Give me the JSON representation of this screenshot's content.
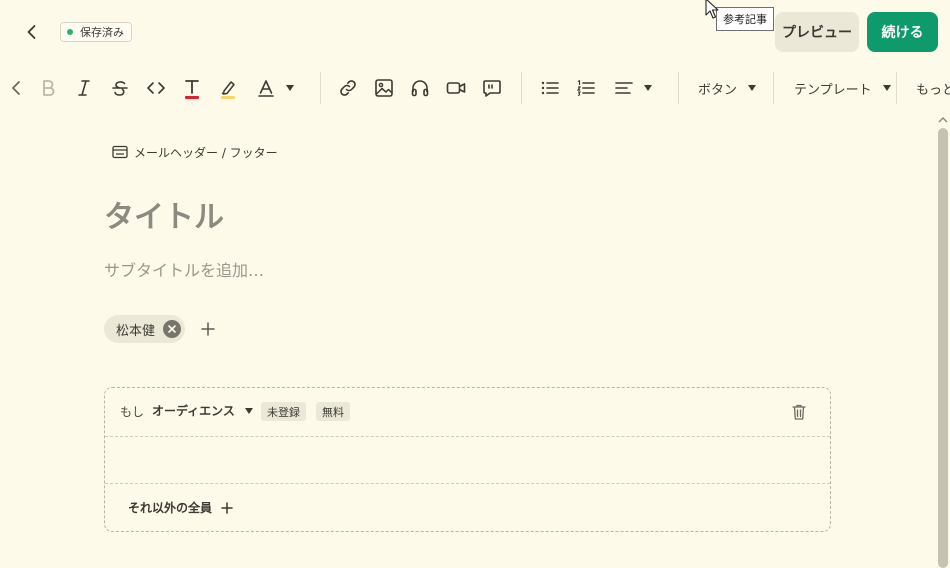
{
  "header": {
    "saved_status": "保存済み",
    "preview_label": "プレビュー",
    "continue_label": "続ける",
    "tooltip": "参考記事"
  },
  "toolbar": {
    "button_label": "ボタン",
    "template_label": "テンプレート",
    "more_label": "もっと見"
  },
  "editor": {
    "header_footer_link": "メールヘッダー / フッター",
    "title_placeholder": "タイトル",
    "subtitle_placeholder": "サブタイトルを追加…",
    "author": "松本健"
  },
  "condition": {
    "if_label": "もし",
    "audience": "オーディエンス",
    "tags": [
      "未登録",
      "無料"
    ],
    "else_label": "それ以外の全員"
  },
  "colors": {
    "background": "#fefae9",
    "accent_green": "#0e9a6a",
    "saved_dot": "#2cb36b",
    "text_color_underline": "#e0202b",
    "highlight_underline": "#f5d86a"
  }
}
